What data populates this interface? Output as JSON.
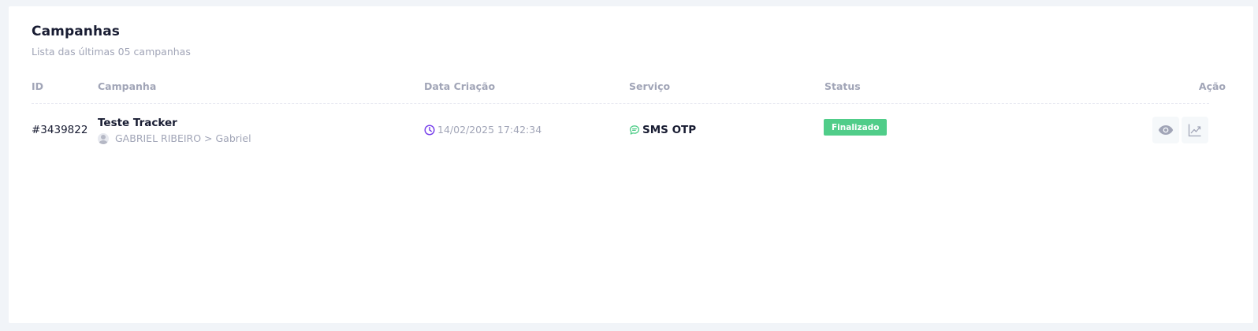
{
  "card": {
    "title": "Campanhas",
    "subtitle": "Lista das últimas 05 campanhas"
  },
  "table": {
    "headers": {
      "id": "ID",
      "campanha": "Campanha",
      "data": "Data Criação",
      "servico": "Serviço",
      "status": "Status",
      "acao": "Ação"
    },
    "rows": [
      {
        "id": "#3439822",
        "name": "Teste Tracker",
        "user": "GABRIEL RIBEIRO > Gabriel",
        "date": "14/02/2025 17:42:34",
        "service": "SMS OTP",
        "status": "Finalizado"
      }
    ]
  },
  "colors": {
    "status_success": "#50cd89",
    "date_icon": "#7239ea",
    "service_icon": "#50cd89",
    "muted_text": "#a1a5b7",
    "title_text": "#181c32"
  },
  "icons": {
    "date": "clock-icon",
    "service": "chat-bubble-icon",
    "view": "eye-icon",
    "report": "chart-trend-icon"
  }
}
